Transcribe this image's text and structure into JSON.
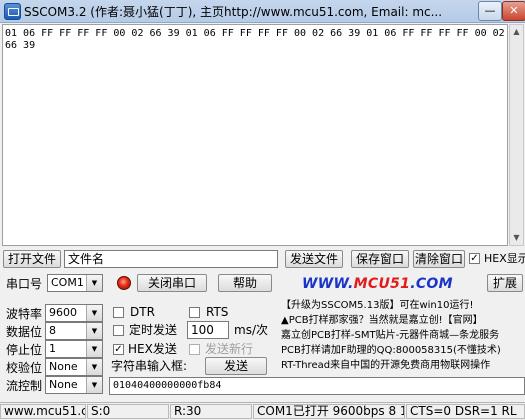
{
  "window": {
    "title": "SSCOM3.2 (作者:聂小猛(丁丁), 主页http://www.mcu51.com,  Email: mc...",
    "minimize_symbol": "—",
    "close_symbol": "✕",
    "app_icon": "serial-port-icon"
  },
  "output": {
    "text": "01 06 FF FF FF FF 00 02 66 39 01 06 FF FF FF FF 00 02 66 39 01 06 FF FF FF FF 00 02 66 39"
  },
  "toolbar1": {
    "open_file_label": "打开文件",
    "filename_value": "文件名",
    "send_file_label": "发送文件",
    "save_window_label": "保存窗口",
    "clear_window_label": "清除窗口",
    "hex_display_label": "HEX显示",
    "hex_display_checked": true
  },
  "toolbar2": {
    "port_label": "串口号",
    "port_value": "COM1",
    "close_port_label": "关闭串口",
    "help_label": "帮助",
    "banner_part1": "WWW.",
    "banner_part2": "MCU51",
    "banner_part3": ".COM",
    "expand_label": "扩展"
  },
  "settings": {
    "baud_label": "波特率",
    "baud_value": "9600",
    "databits_label": "数据位",
    "databits_value": "8",
    "stopbits_label": "停止位",
    "stopbits_value": "1",
    "parity_label": "校验位",
    "parity_value": "None",
    "flow_label": "流控制",
    "flow_value": "None"
  },
  "options": {
    "dtr_label": "DTR",
    "rts_label": "RTS",
    "timed_send_label": "定时发送",
    "interval_value": "100",
    "interval_unit": "ms/次",
    "hex_send_label": "HEX发送",
    "hex_send_checked": true,
    "send_newline_label": "发送新行",
    "input_label": "字符串输入框:",
    "send_label": "发送",
    "input_value": "01040400000000fb84"
  },
  "ad": {
    "line1": "【升级为SSCOM5.13版】可在win10运行!",
    "line2": "▲PCB打样那家强？当然就是嘉立创!【官网】",
    "line3": "嘉立创PCB打样-SMT贴片-元器件商城—条龙服务",
    "line4": "PCB打样请加F助理的QQ:800058315(不懂技术)",
    "line5": "RT-Thread来自中国的开源免费商用物联网操作"
  },
  "status": {
    "site": "www.mcu51.cor",
    "sent": "S:0",
    "received": "R:30",
    "port_state": "COM1已打开  9600bps  8  1  None  None",
    "signals": "CTS=0 DSR=1 RL"
  }
}
